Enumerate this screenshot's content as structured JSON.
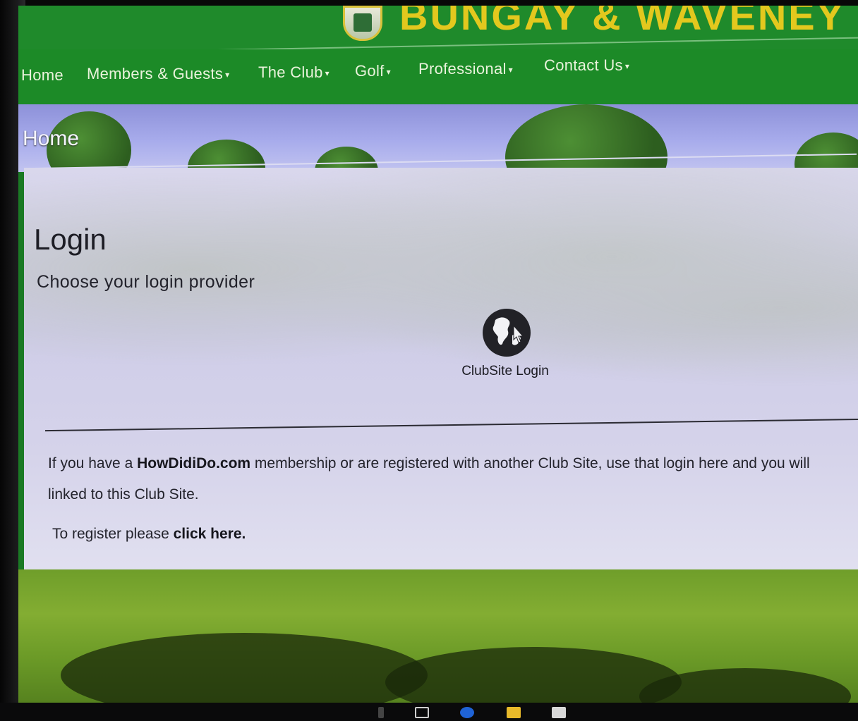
{
  "site": {
    "name": "BUNGAY & WAVENEY"
  },
  "nav": {
    "items": [
      {
        "label": "Home",
        "has_menu": false
      },
      {
        "label": "Members & Guests",
        "has_menu": true
      },
      {
        "label": "The Club",
        "has_menu": true
      },
      {
        "label": "Golf",
        "has_menu": true
      },
      {
        "label": "Professional",
        "has_menu": true
      },
      {
        "label": "Contact Us",
        "has_menu": true
      }
    ],
    "caret": "▾"
  },
  "hero": {
    "title": "Home"
  },
  "login": {
    "title": "Login",
    "subtitle": "Choose your login provider",
    "provider_label": "ClubSite Login",
    "info_prefix": "If you have a ",
    "info_brand": "HowDidiDo.com",
    "info_suffix": " membership or are registered with another Club Site, use that login here and you will",
    "info_line2": "linked to this Club Site.",
    "register_prefix": "To register please ",
    "register_link": "click here."
  },
  "colors": {
    "header_green": "#1f8a2b",
    "brand_gold": "#e3c81e",
    "panel_bg": "#d7d5eb",
    "grass": "#7aa62f"
  },
  "icons": {
    "provider": "globe-pointer-icon"
  }
}
